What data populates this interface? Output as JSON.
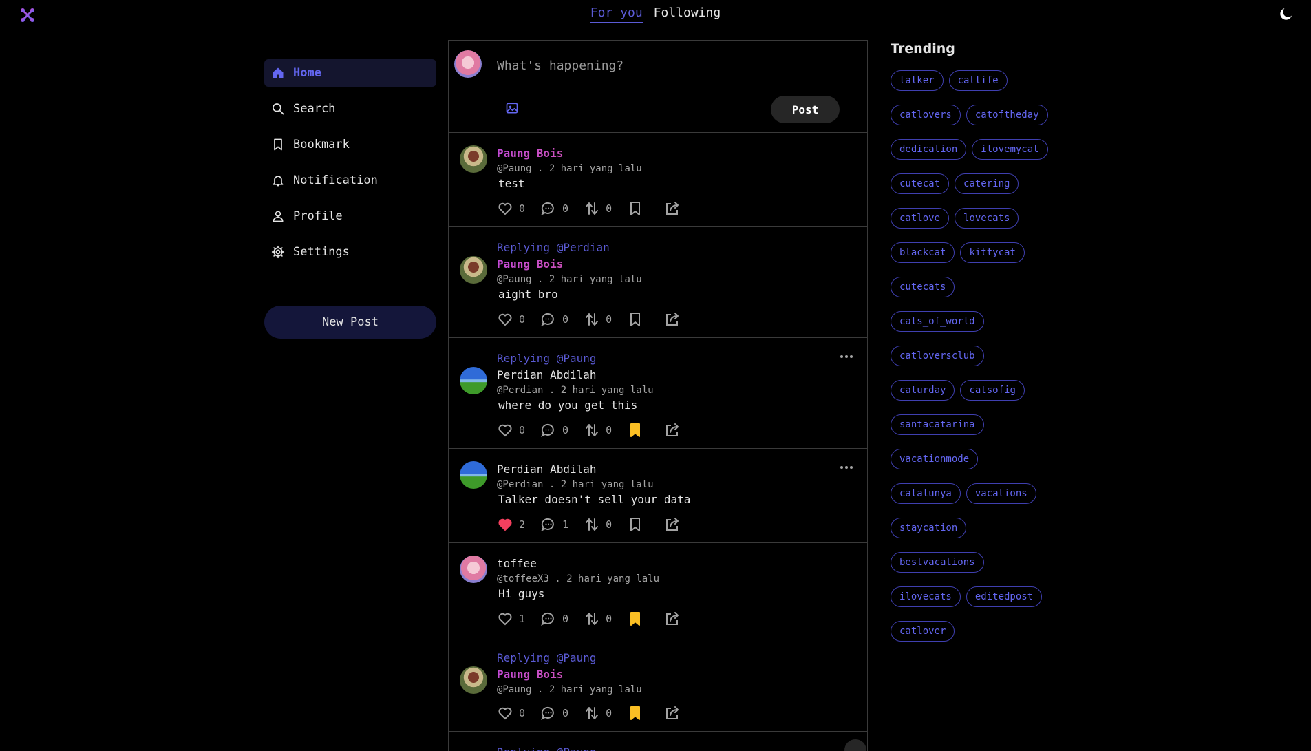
{
  "header": {
    "tabs": [
      {
        "label": "For you",
        "active": true
      },
      {
        "label": "Following",
        "active": false
      }
    ],
    "logo_icon": "talker-logo-icon",
    "theme_icon": "moon-icon"
  },
  "sidebar": {
    "items": [
      {
        "label": "Home",
        "icon": "home-icon",
        "active": true
      },
      {
        "label": "Search",
        "icon": "search-icon"
      },
      {
        "label": "Bookmark",
        "icon": "bookmark-icon"
      },
      {
        "label": "Notification",
        "icon": "bell-icon"
      },
      {
        "label": "Profile",
        "icon": "user-icon"
      },
      {
        "label": "Settings",
        "icon": "gear-icon"
      }
    ],
    "new_post_label": "New Post"
  },
  "composer": {
    "placeholder": "What's happening?",
    "post_label": "Post"
  },
  "posts": [
    {
      "replying": "",
      "author": "Paung Bois",
      "handle": "@Paung",
      "time": "2 hari yang lalu",
      "content": "test",
      "likes": "0",
      "comments": "0",
      "reposts": "0",
      "liked": false,
      "bookmarked": false
    },
    {
      "replying": "Replying @Perdian",
      "author": "Paung Bois",
      "handle": "@Paung",
      "time": "2 hari yang lalu",
      "content": "aight bro",
      "likes": "0",
      "comments": "0",
      "reposts": "0",
      "liked": false,
      "bookmarked": false
    },
    {
      "replying": "Replying @Paung",
      "author": "Perdian Abdilah",
      "handle": "@Perdian",
      "time": "2 hari yang lalu",
      "content": "where do you get this",
      "likes": "0",
      "comments": "0",
      "reposts": "0",
      "liked": false,
      "bookmarked": true
    },
    {
      "replying": "",
      "author": "Perdian Abdilah",
      "handle": "@Perdian",
      "time": "2 hari yang lalu",
      "content": "Talker doesn't sell your data",
      "likes": "2",
      "comments": "1",
      "reposts": "0",
      "liked": true,
      "bookmarked": false
    },
    {
      "replying": "",
      "author": "toffee",
      "handle": "@toffeeX3",
      "time": "2 hari yang lalu",
      "content": "Hi guys",
      "likes": "1",
      "comments": "0",
      "reposts": "0",
      "liked": false,
      "bookmarked": true
    },
    {
      "replying": "Replying @Paung",
      "author": "Paung Bois",
      "handle": "@Paung",
      "time": "2 hari yang lalu",
      "content": "",
      "likes": "0",
      "comments": "0",
      "reposts": "0",
      "liked": false,
      "bookmarked": true
    },
    {
      "replying": "Replying @Paung",
      "author": "",
      "handle": "",
      "time": "",
      "content": "",
      "likes": "",
      "comments": "",
      "reposts": "",
      "liked": false,
      "bookmarked": false
    }
  ],
  "trending": {
    "title": "Trending",
    "tags": [
      "talker",
      "catlife",
      "catlovers",
      "catoftheday",
      "dedication",
      "ilovemycat",
      "cutecat",
      "catering",
      "catlove",
      "lovecats",
      "blackcat",
      "kittycat",
      "cutecats",
      "cats_of_world",
      "catloversclub",
      "caturday",
      "catsofig",
      "santacatarina",
      "vacationmode",
      "catalunya",
      "vacations",
      "staycation",
      "bestvacations",
      "ilovecats",
      "editedpost",
      "catlover"
    ]
  },
  "colors": {
    "accent": "#6366f1",
    "liked": "#f43f5e",
    "bookmarked": "#fbbf24",
    "background": "#000000"
  }
}
